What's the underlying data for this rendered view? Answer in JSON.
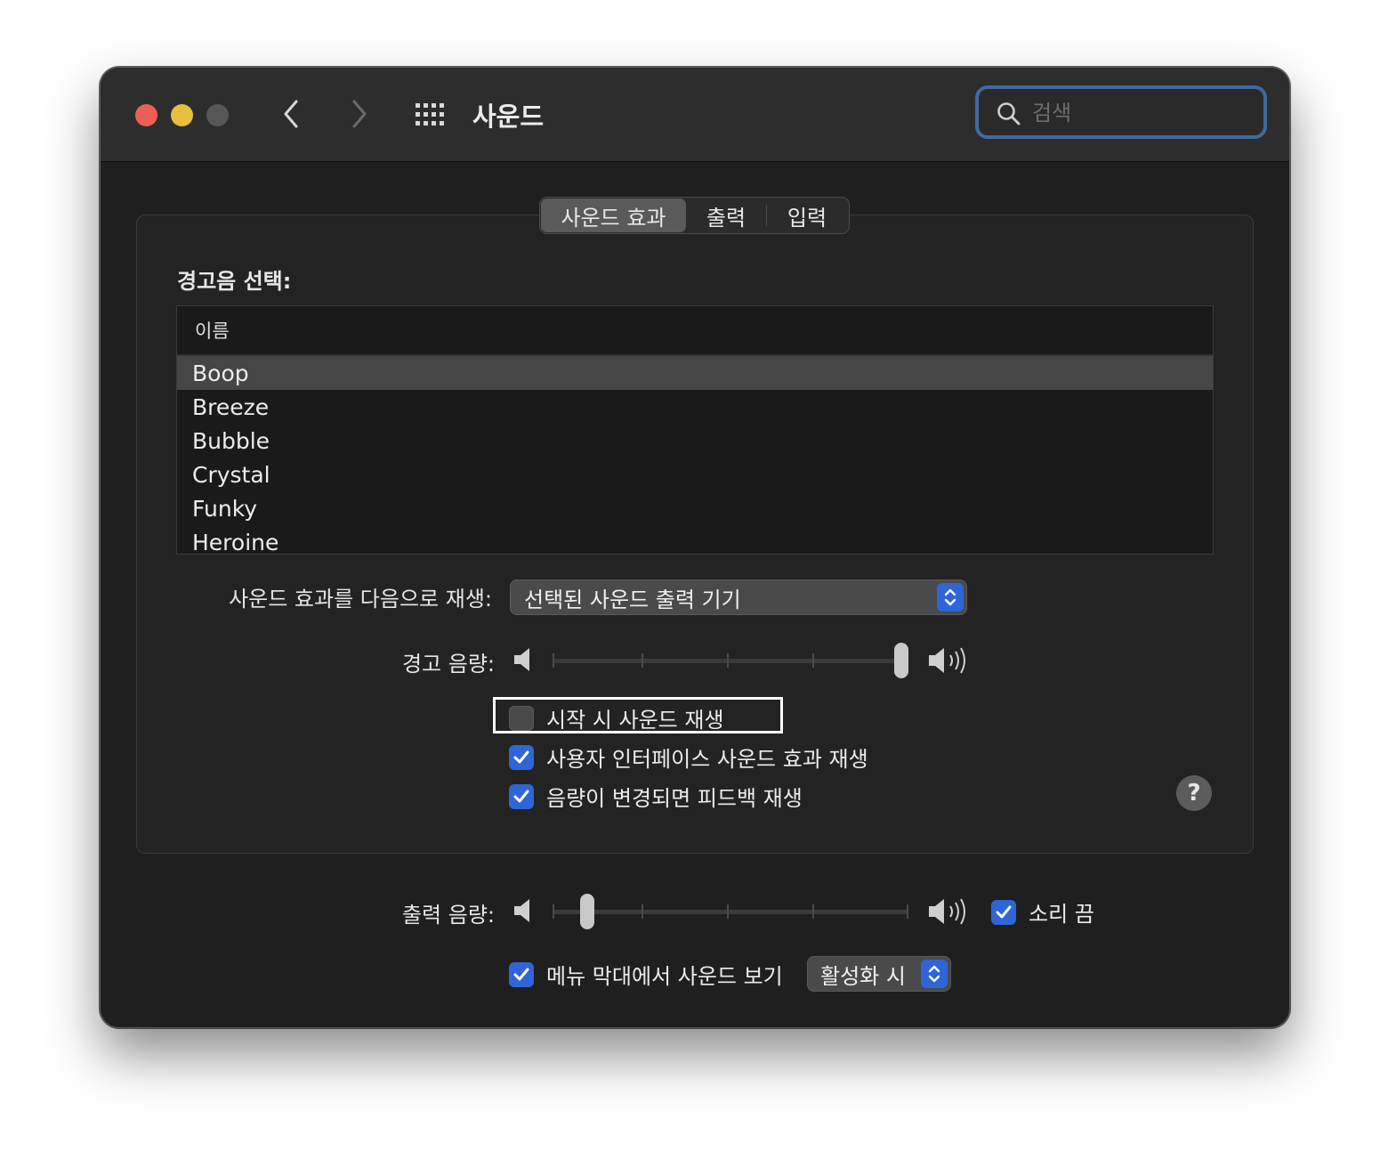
{
  "window": {
    "title": "사운드",
    "search_placeholder": "검색"
  },
  "tabs": [
    {
      "label": "사운드 효과",
      "active": true
    },
    {
      "label": "출력",
      "active": false
    },
    {
      "label": "입력",
      "active": false
    }
  ],
  "alert": {
    "label": "경고음 선택:",
    "column_header": "이름",
    "sounds": [
      "Boop",
      "Breeze",
      "Bubble",
      "Crystal",
      "Funky",
      "Heroine"
    ],
    "selected": "Boop"
  },
  "play_through": {
    "label": "사운드 효과를 다음으로 재생:",
    "value": "선택된 사운드 출력 기기"
  },
  "alert_volume": {
    "label": "경고 음량:",
    "level": 1.0
  },
  "options": [
    {
      "label": "시작 시 사운드 재생",
      "checked": false
    },
    {
      "label": "사용자 인터페이스 사운드 효과 재생",
      "checked": true
    },
    {
      "label": "음량이 변경되면 피드백 재생",
      "checked": true
    }
  ],
  "help_label": "?",
  "output_volume": {
    "label": "출력 음량:",
    "level": 0.08,
    "mute_label": "소리 끔",
    "mute_checked": true
  },
  "menubar": {
    "label": "메뉴 막대에서 사운드 보기",
    "checked": true,
    "value": "활성화 시"
  },
  "colors": {
    "accent": "#2f65d6",
    "close": "#ec5f57",
    "minimize": "#e6bf3e",
    "search_focus": "#3f6aa0"
  }
}
